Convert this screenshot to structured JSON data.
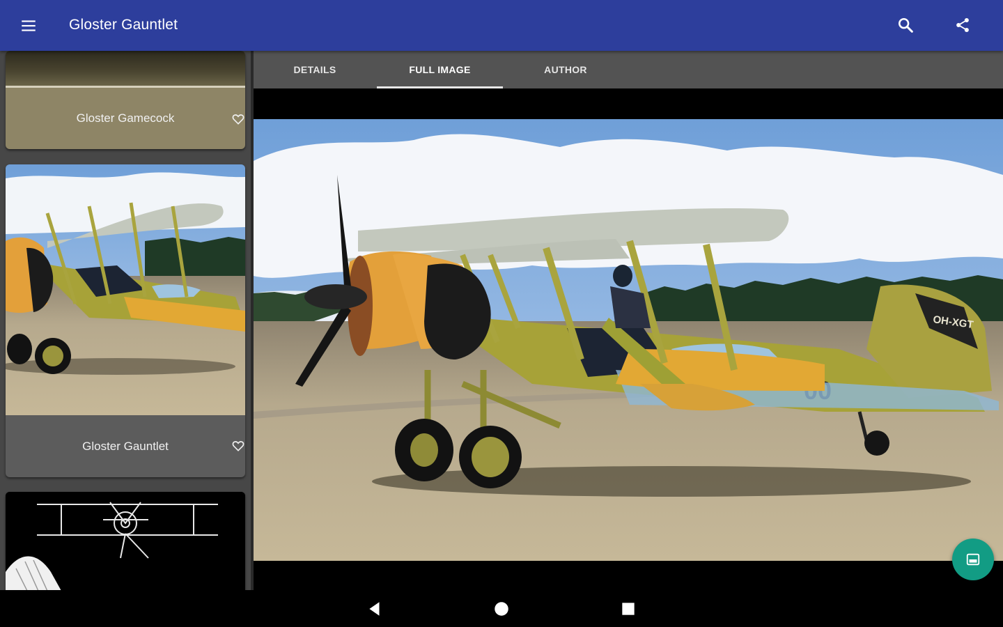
{
  "app_bar": {
    "title": "Gloster Gauntlet",
    "icons": [
      "menu-icon",
      "search-icon",
      "share-icon"
    ],
    "color": "#2d3e9c"
  },
  "list": {
    "items": [
      {
        "caption": "Gloster Gamecock",
        "icon": "heart-outline-icon"
      },
      {
        "caption": "Gloster Gauntlet",
        "icon": "heart-outline-icon"
      },
      {
        "caption": "",
        "icon": ""
      }
    ]
  },
  "tabs": {
    "items": [
      {
        "label": "DETAILS"
      },
      {
        "label": "FULL IMAGE"
      },
      {
        "label": "AUTHOR"
      }
    ],
    "selected": "FULL IMAGE"
  },
  "viewer": {
    "photo_markings": {
      "fuselage_number": "00",
      "tail_code": "OH-XGT"
    }
  },
  "fab": {
    "icon": "image-icon",
    "color": "#129c84"
  },
  "nav_bar": {
    "icons": [
      "back-icon",
      "home-icon",
      "recents-icon"
    ]
  }
}
